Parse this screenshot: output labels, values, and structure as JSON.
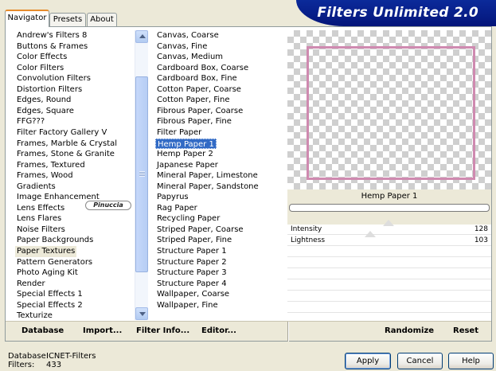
{
  "tabs": [
    {
      "label": "Navigator"
    },
    {
      "label": "Presets"
    },
    {
      "label": "About"
    }
  ],
  "title": "Filters Unlimited 2.0",
  "categories": [
    "Andrew's Filters 8",
    "Buttons & Frames",
    "Color Effects",
    "Color Filters",
    "Convolution Filters",
    "Distortion Filters",
    "Edges, Round",
    "Edges, Square",
    "FFG???",
    "Filter Factory Gallery V",
    "Frames, Marble & Crystal",
    "Frames, Stone & Granite",
    "Frames, Textured",
    "Frames, Wood",
    "Gradients",
    "Image Enhancement",
    "Lens Effects",
    "Lens Flares",
    "Noise Filters",
    "Paper Backgrounds",
    "Paper Textures",
    "Pattern Generators",
    "Photo Aging Kit",
    "Render",
    "Special Effects 1",
    "Special Effects 2",
    "Texturize"
  ],
  "filters": [
    "Canvas, Coarse",
    "Canvas, Fine",
    "Canvas, Medium",
    "Cardboard Box, Coarse",
    "Cardboard Box, Fine",
    "Cotton Paper, Coarse",
    "Cotton Paper, Fine",
    "Fibrous Paper, Coarse",
    "Fibrous Paper, Fine",
    "Filter Paper",
    "Hemp Paper 1",
    "Hemp Paper 2",
    "Japanese Paper",
    "Mineral Paper, Limestone",
    "Mineral Paper, Sandstone",
    "Papyrus",
    "Rag Paper",
    "Recycling Paper",
    "Striped Paper, Coarse",
    "Striped Paper, Fine",
    "Structure Paper 1",
    "Structure Paper 2",
    "Structure Paper 3",
    "Structure Paper 4",
    "Wallpaper, Coarse",
    "Wallpaper, Fine"
  ],
  "selected_category": "Paper Textures",
  "selected_filter": "Hemp Paper 1",
  "watermark": "Pinuccia",
  "preview_filter_name": "Hemp Paper 1",
  "sliders": [
    {
      "label": "Intensity",
      "value": "128"
    },
    {
      "label": "Lightness",
      "value": "103"
    }
  ],
  "toolbar": {
    "database": "Database",
    "import": "Import...",
    "filter_info": "Filter Info...",
    "editor": "Editor...",
    "randomize": "Randomize",
    "reset": "Reset"
  },
  "status": {
    "database_label": "Database:",
    "database_value": "ICNET-Filters",
    "filters_label": "Filters:",
    "filters_value": "433"
  },
  "buttons": {
    "apply": "Apply",
    "cancel": "Cancel",
    "help": "Help"
  },
  "colors": {
    "banner": "#0b2a9a",
    "selection": "#316ac5",
    "frame": "#cf8ab0"
  }
}
